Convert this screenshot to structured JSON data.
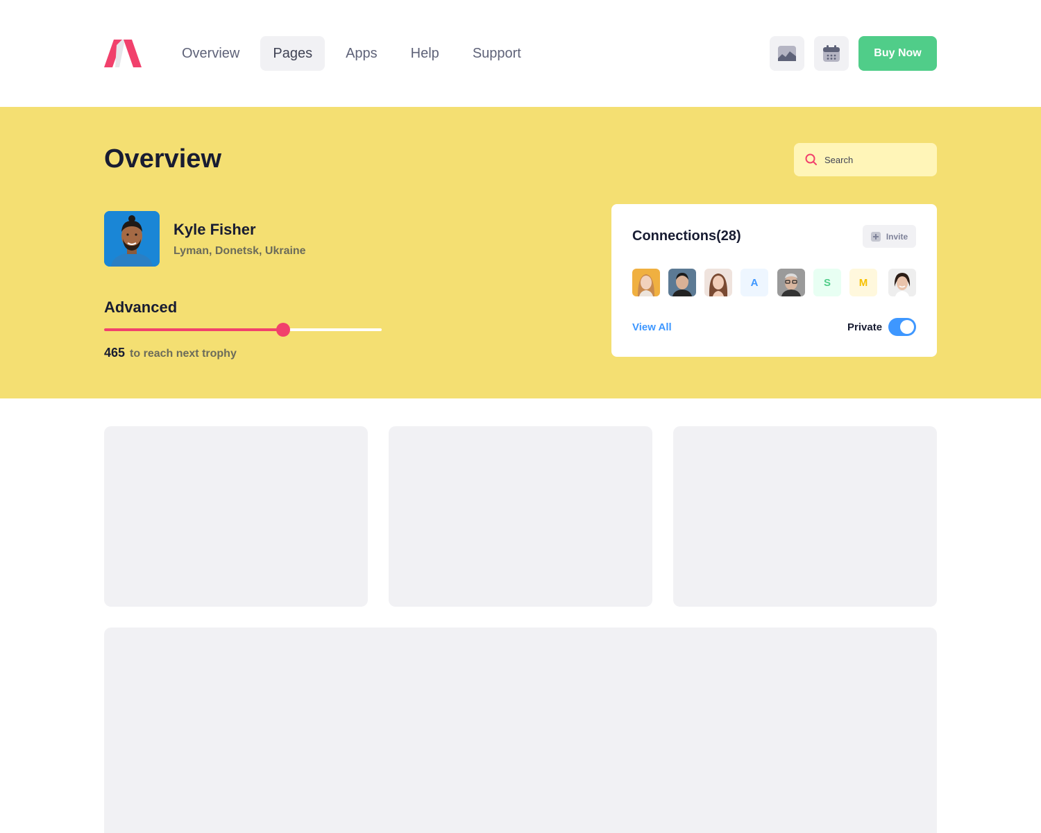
{
  "header": {
    "nav": [
      {
        "label": "Overview",
        "active": false
      },
      {
        "label": "Pages",
        "active": true
      },
      {
        "label": "Apps",
        "active": false
      },
      {
        "label": "Help",
        "active": false
      },
      {
        "label": "Support",
        "active": false
      }
    ],
    "icons": [
      "chart-icon",
      "calendar-icon"
    ],
    "buy_label": "Buy Now",
    "colors": {
      "brand": "#f1416c",
      "buy": "#50cd89"
    }
  },
  "hero": {
    "title": "Overview",
    "search_placeholder": "Search",
    "background": "#f4df72",
    "user": {
      "name": "Kyle Fisher",
      "location": "Lyman, Donetsk, Ukraine"
    },
    "level": {
      "label": "Advanced",
      "progress": 0.645,
      "points": "465",
      "points_text": "to reach next trophy"
    }
  },
  "connections": {
    "title": "Connections(28)",
    "invite_label": "Invite",
    "avatars": [
      {
        "type": "photo",
        "name": "woman-blonde"
      },
      {
        "type": "photo",
        "name": "man-dark-hair"
      },
      {
        "type": "photo",
        "name": "woman-brunette"
      },
      {
        "type": "initial",
        "letter": "A",
        "bg": "#eef6ff",
        "fg": "#3e97ff"
      },
      {
        "type": "photo",
        "name": "man-glasses"
      },
      {
        "type": "initial",
        "letter": "S",
        "bg": "#e8fff3",
        "fg": "#50cd89"
      },
      {
        "type": "initial",
        "letter": "M",
        "bg": "#fff8dd",
        "fg": "#f6c000"
      },
      {
        "type": "photo",
        "name": "woman-smiling"
      }
    ],
    "view_all_label": "View All",
    "private_label": "Private",
    "private_on": true
  }
}
